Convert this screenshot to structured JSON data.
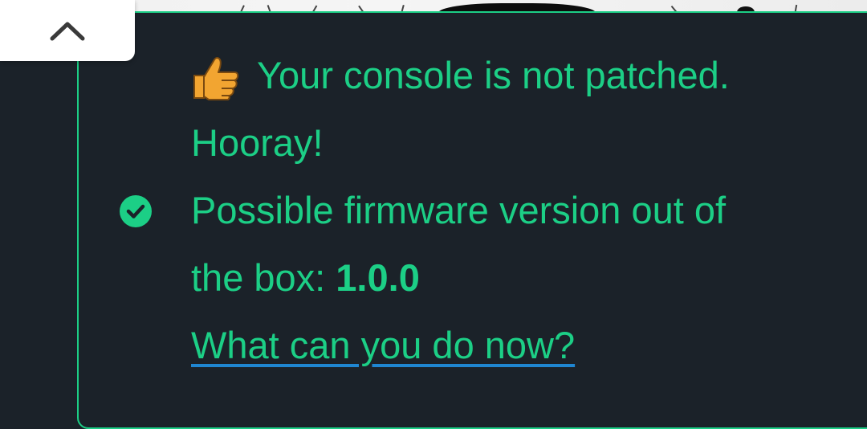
{
  "result": {
    "status_text": "Your console is not patched.",
    "exclaim_text": "Hooray!",
    "firmware_label_part1": "Possible firmware version out of",
    "firmware_label_part2": "the box: ",
    "firmware_version": "1.0.0",
    "help_link": "What can you do now?"
  },
  "icons": {
    "thumb": "thumbs-up-icon",
    "check": "check-circle-icon",
    "back_to_top": "chevron-up-icon"
  },
  "colors": {
    "background": "#1b2229",
    "accent": "#1ccf86",
    "link_underline": "#1f86d1",
    "thumb": "#f2a531"
  }
}
